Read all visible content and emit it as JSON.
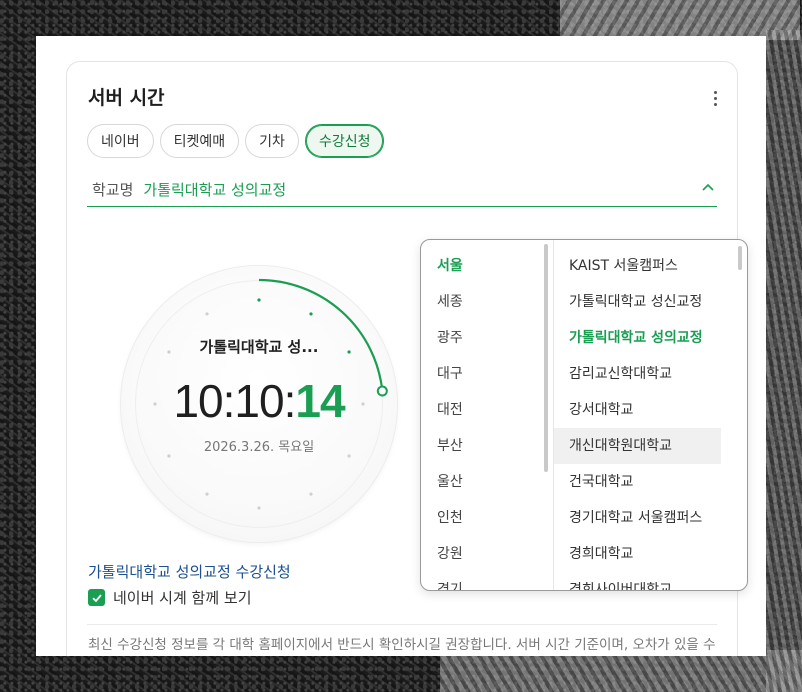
{
  "card": {
    "title": "서버 시간"
  },
  "tabs": [
    {
      "label": "네이버",
      "active": false
    },
    {
      "label": "티켓예매",
      "active": false
    },
    {
      "label": "기차",
      "active": false
    },
    {
      "label": "수강신청",
      "active": true
    }
  ],
  "school_select": {
    "label": "학교명",
    "value": "가톨릭대학교 성의교정"
  },
  "clock": {
    "school": "가톨릭대학교 성...",
    "time_hm": "10:10:",
    "time_s": "14",
    "date": "2026.3.26. 목요일",
    "seconds": 14
  },
  "status_link": "가톨릭대학교 성의교정 수강신청",
  "naver_clock_checkbox": {
    "label": "네이버 시계 함께 보기",
    "checked": true
  },
  "notice": "최신 수강신청 정보를 각 대학 홈페이지에서 반드시 확인하시길 권장합니다. 서버 시간 기준이며, 오차가 있을 수 있습니다.",
  "dropdown": {
    "regions": [
      {
        "label": "서울",
        "active": true
      },
      {
        "label": "세종"
      },
      {
        "label": "광주"
      },
      {
        "label": "대구"
      },
      {
        "label": "대전"
      },
      {
        "label": "부산"
      },
      {
        "label": "울산"
      },
      {
        "label": "인천"
      },
      {
        "label": "강원"
      },
      {
        "label": "경기"
      }
    ],
    "schools": [
      {
        "label": "KAIST 서울캠퍼스"
      },
      {
        "label": "가톨릭대학교 성신교정"
      },
      {
        "label": "가톨릭대학교 성의교정",
        "active": true
      },
      {
        "label": "감리교신학대학교"
      },
      {
        "label": "강서대학교"
      },
      {
        "label": "개신대학원대학교",
        "hover": true
      },
      {
        "label": "건국대학교"
      },
      {
        "label": "경기대학교 서울캠퍼스"
      },
      {
        "label": "경희대학교"
      },
      {
        "label": "경희사이버대학교"
      }
    ]
  },
  "colors": {
    "accent": "#1a9e52",
    "link": "#1c4f8f"
  }
}
